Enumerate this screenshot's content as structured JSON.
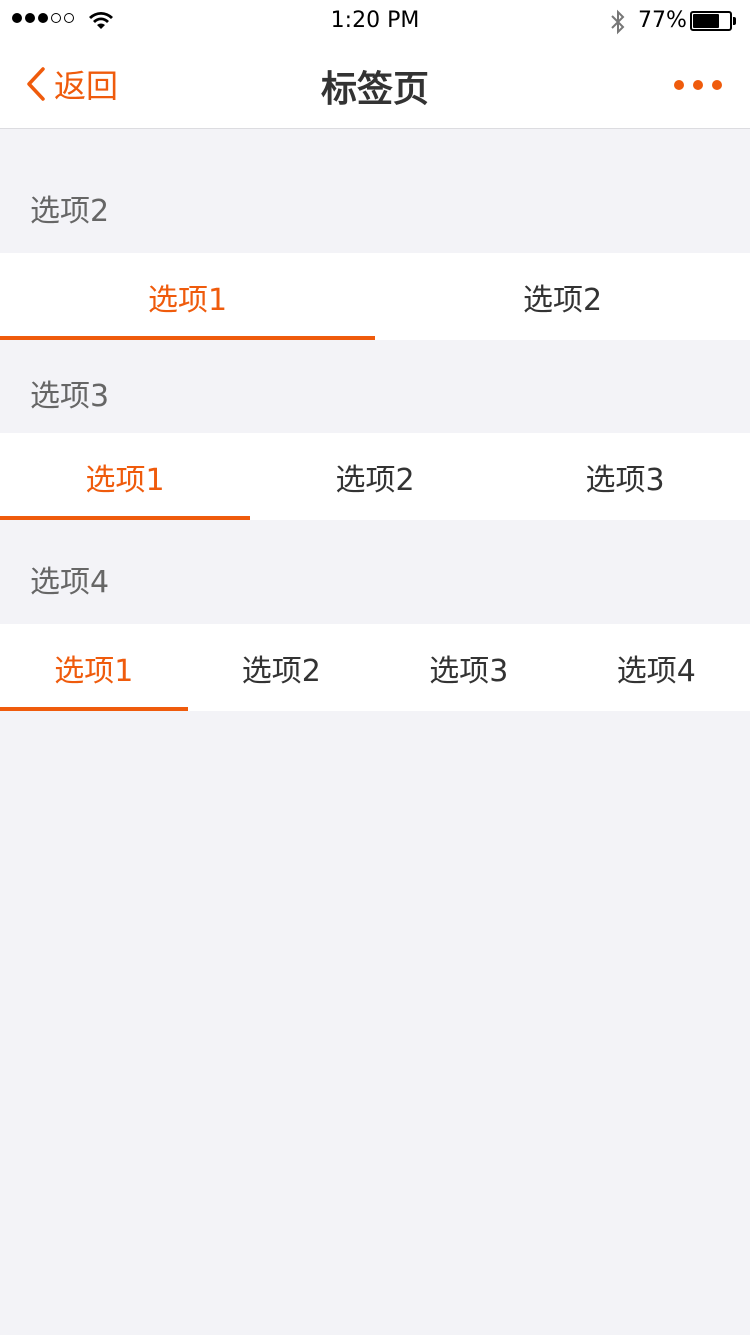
{
  "status_bar": {
    "time": "1:20 PM",
    "battery_percent": "77%",
    "battery_level": 0.77,
    "signal_bars": 3,
    "signal_total": 5
  },
  "nav": {
    "back_label": "返回",
    "title": "标签页"
  },
  "colors": {
    "accent": "#ef5b0c",
    "background": "#f3f3f7"
  },
  "sections": [
    {
      "label": "选项2",
      "tabs": [
        "选项1",
        "选项2"
      ],
      "active_index": 0
    },
    {
      "label": "选项3",
      "tabs": [
        "选项1",
        "选项2",
        "选项3"
      ],
      "active_index": 0
    },
    {
      "label": "选项4",
      "tabs": [
        "选项1",
        "选项2",
        "选项3",
        "选项4"
      ],
      "active_index": 0
    }
  ]
}
